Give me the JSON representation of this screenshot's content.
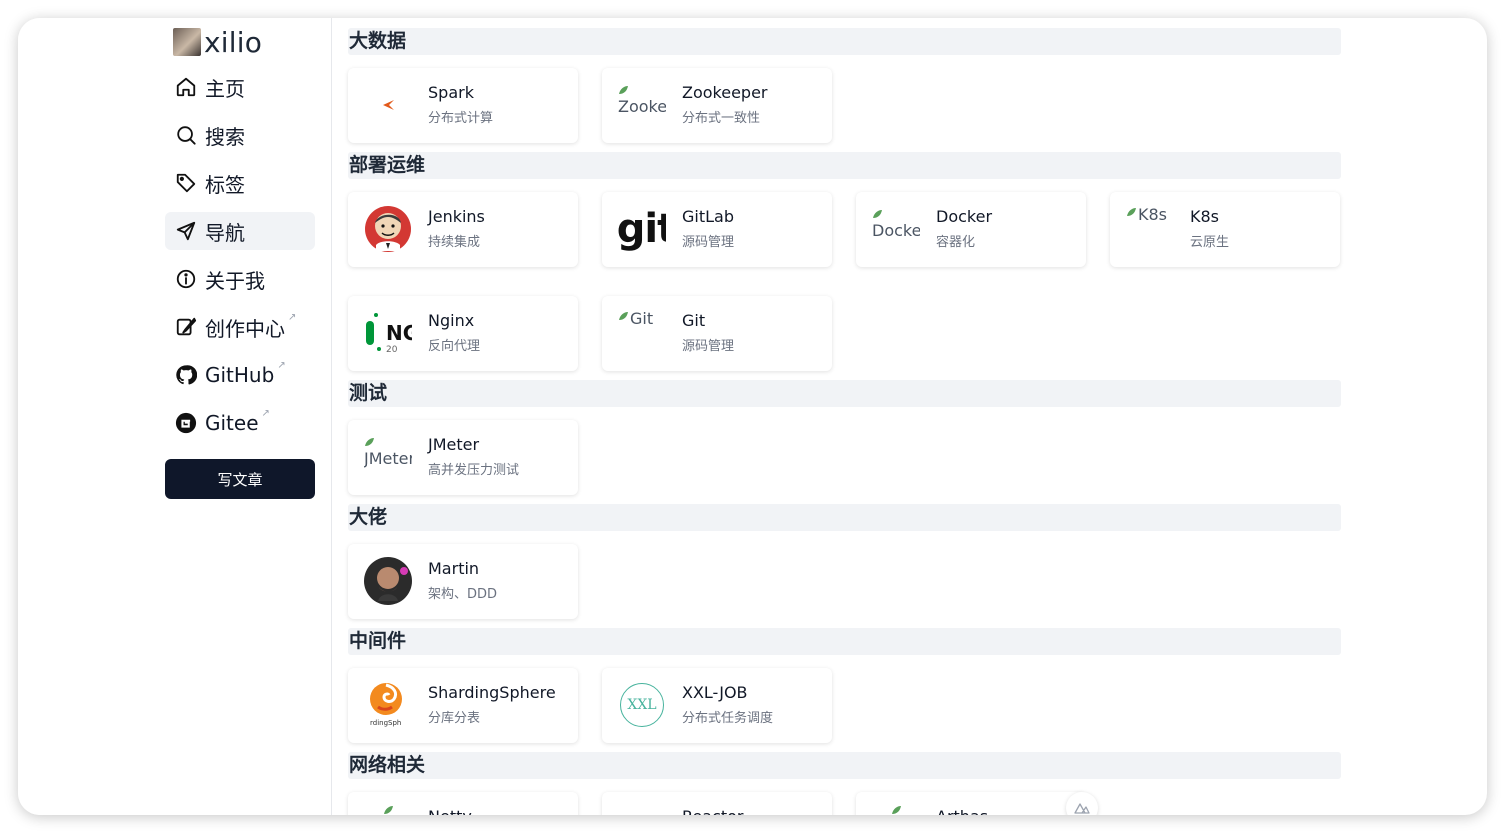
{
  "brand": {
    "name": "xilio",
    "avatar": "user-avatar"
  },
  "nav": {
    "items": [
      {
        "label": "主页",
        "icon": "home-icon"
      },
      {
        "label": "搜索",
        "icon": "search-icon"
      },
      {
        "label": "标签",
        "icon": "tag-icon"
      },
      {
        "label": "导航",
        "icon": "send-icon",
        "active": true
      },
      {
        "label": "关于我",
        "icon": "info-icon"
      },
      {
        "label": "创作中心",
        "icon": "quill-icon",
        "external": true
      },
      {
        "label": "GitHub",
        "icon": "github-icon",
        "external": true
      },
      {
        "label": "Gitee",
        "icon": "gitee-icon",
        "external": true
      }
    ],
    "external_mark": "↗",
    "write_button": "写文章"
  },
  "sections": [
    {
      "title": "大数据",
      "cards": [
        {
          "name": "Spark",
          "desc": "分布式计算"
        },
        {
          "name": "Zookeeper",
          "desc": "分布式一致性",
          "alt": "Zookeeper"
        }
      ]
    },
    {
      "title": "部署运维",
      "cards": [
        {
          "name": "Jenkins",
          "desc": "持续集成"
        },
        {
          "name": "GitLab",
          "desc": "源码管理"
        },
        {
          "name": "Docker",
          "desc": "容器化",
          "alt": "Docker"
        },
        {
          "name": "K8s",
          "desc": "云原生",
          "alt": "K8s"
        },
        {
          "name": "Nginx",
          "desc": "反向代理"
        },
        {
          "name": "Git",
          "desc": "源码管理",
          "alt": "Git"
        }
      ]
    },
    {
      "title": "测试",
      "cards": [
        {
          "name": "JMeter",
          "desc": "高并发压力测试",
          "alt": "JMeter"
        }
      ]
    },
    {
      "title": "大佬",
      "cards": [
        {
          "name": "Martin",
          "desc": "架构、DDD"
        }
      ]
    },
    {
      "title": "中间件",
      "cards": [
        {
          "name": "ShardingSphere",
          "desc": "分库分表"
        },
        {
          "name": "XXL-JOB",
          "desc": "分布式任务调度"
        }
      ]
    },
    {
      "title": "网络相关",
      "cards": [
        {
          "name": "Netty"
        },
        {
          "name": "Reactor"
        },
        {
          "name": "Arthas"
        }
      ]
    }
  ],
  "logo_text": {
    "gitlab": "git",
    "nginx": "NG",
    "nginx_sub": "20",
    "sharding": "rdingSph",
    "xxl": "XXL"
  },
  "colors": {
    "accent": "#0f172a",
    "section_bg": "#f1f3f6",
    "spark": "#e25a1c",
    "xxl": "#47b39d"
  }
}
